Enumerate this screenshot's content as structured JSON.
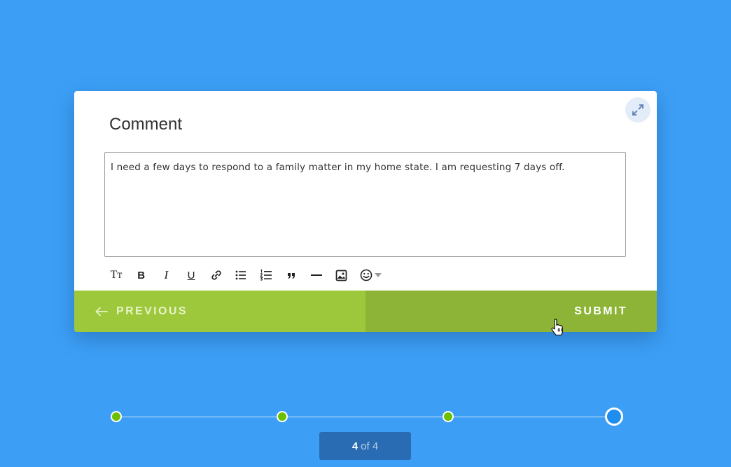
{
  "form": {
    "title": "Comment",
    "comment_value": "I need a few days to respond to a family matter in my home state. I am requesting 7 days off.",
    "toolbar": [
      {
        "name": "text-size-icon",
        "text": "Tт"
      },
      {
        "name": "bold-icon",
        "text": "B"
      },
      {
        "name": "italic-icon",
        "text": "I"
      },
      {
        "name": "underline-icon",
        "text": "U"
      },
      {
        "name": "link-icon"
      },
      {
        "name": "bullet-list-icon"
      },
      {
        "name": "numbered-list-icon"
      },
      {
        "name": "quote-icon"
      },
      {
        "name": "horizontal-rule-icon"
      },
      {
        "name": "image-icon"
      },
      {
        "name": "emoji-icon"
      }
    ],
    "previous_label": "PREVIOUS",
    "submit_label": "SUBMIT"
  },
  "progress": {
    "current": "4",
    "of_label": "of 4",
    "steps": [
      "completed",
      "completed",
      "completed",
      "current"
    ]
  },
  "colors": {
    "background": "#3c9ff5",
    "previous_button": "#9dc83b",
    "submit_button": "#8db437",
    "step_completed": "#6cc000",
    "step_current": "#1f8ded",
    "counter_bg": "#2a6cb3"
  }
}
